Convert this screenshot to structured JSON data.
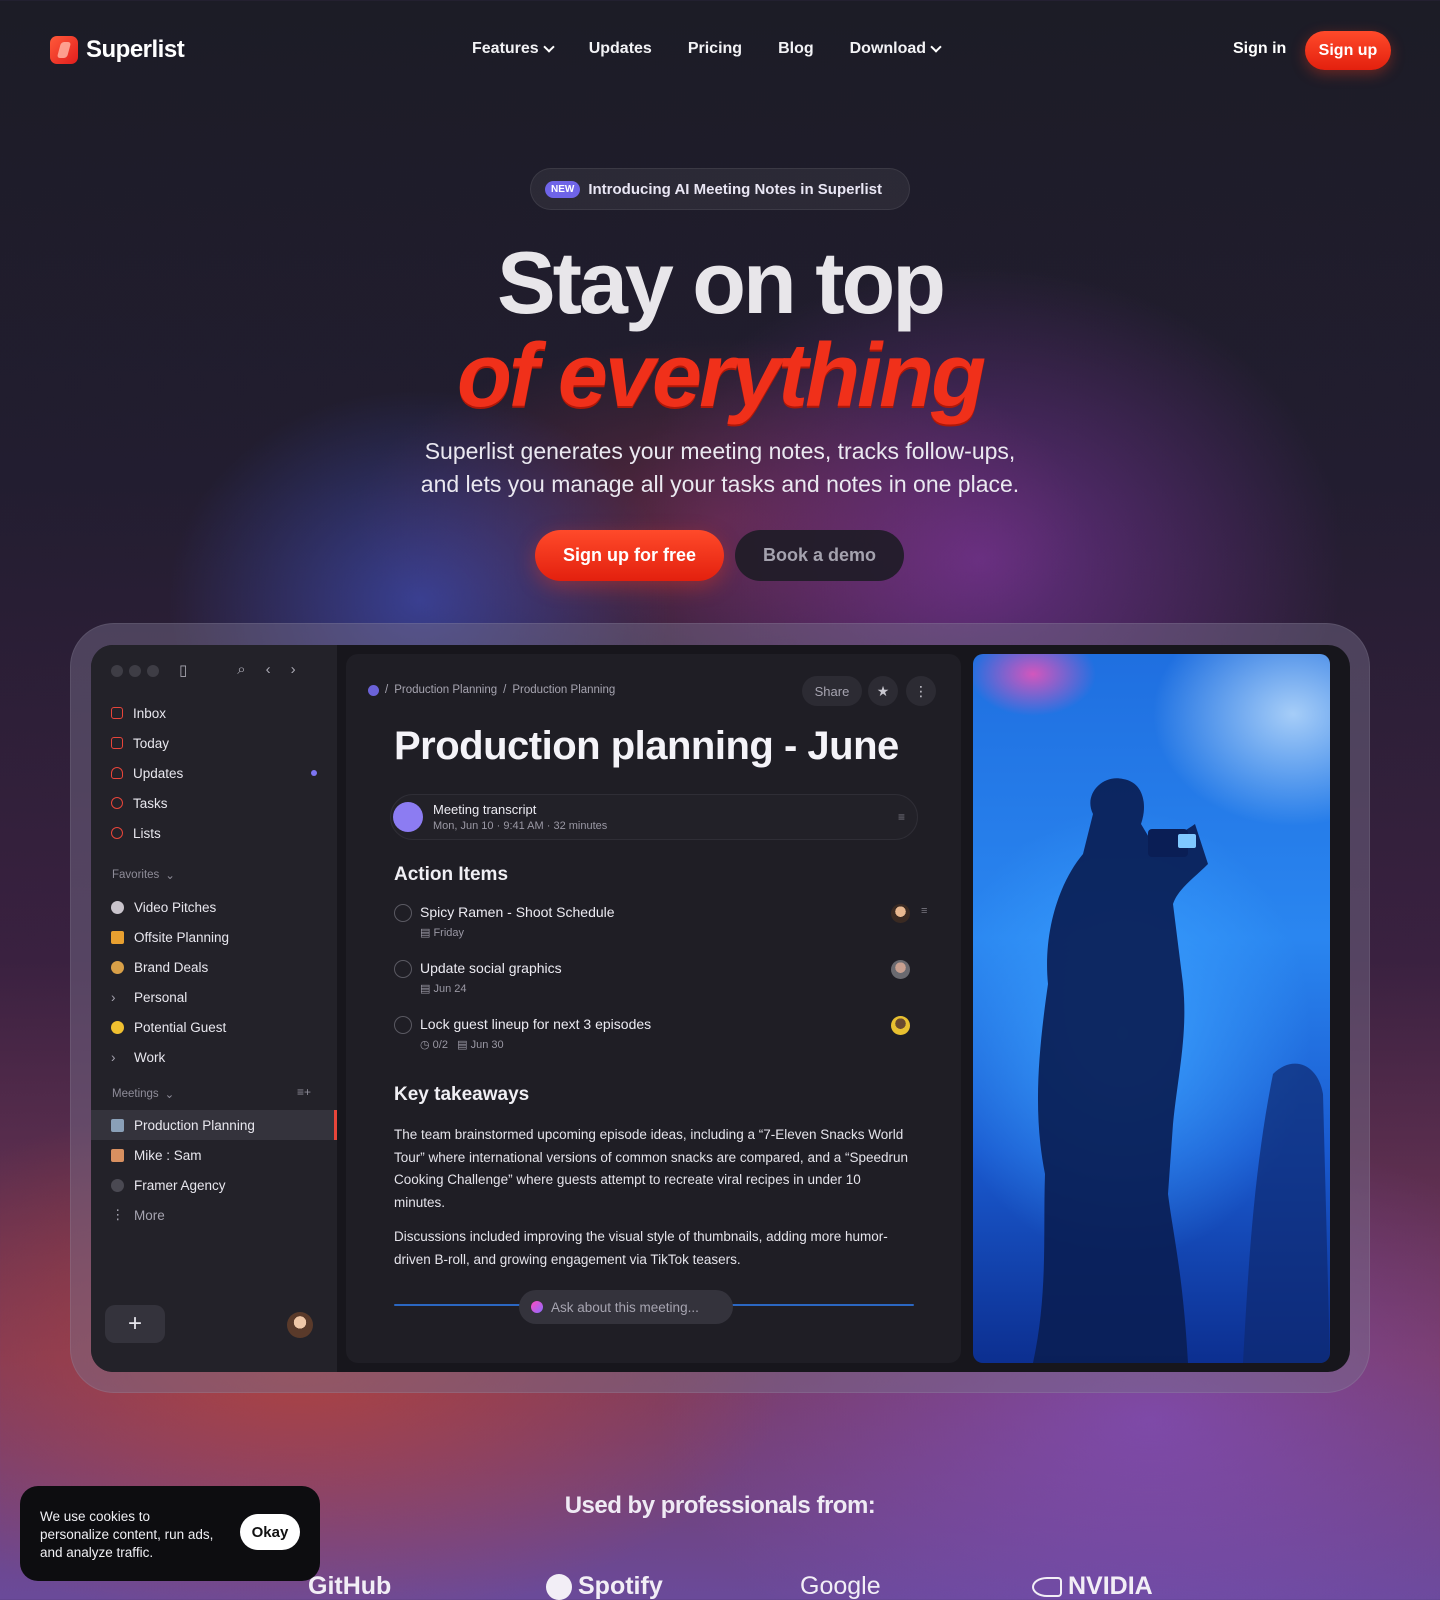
{
  "nav": {
    "brand": "Superlist",
    "links": [
      {
        "label": "Features",
        "dropdown": true
      },
      {
        "label": "Updates"
      },
      {
        "label": "Pricing"
      },
      {
        "label": "Blog"
      },
      {
        "label": "Download",
        "dropdown": true
      }
    ],
    "sign_in": "Sign in",
    "sign_up": "Sign up"
  },
  "hero": {
    "badge": "NEW",
    "announcement": "Introducing AI Meeting Notes in Superlist",
    "title_line1": "Stay on top",
    "title_line2": "of everything",
    "subtitle_line1": "Superlist generates your meeting notes, tracks follow-ups,",
    "subtitle_line2": "and lets you manage all your tasks and notes in one place.",
    "cta_primary": "Sign up for free",
    "cta_secondary": "Book a demo"
  },
  "app": {
    "sidebar": {
      "main": [
        {
          "label": "Inbox",
          "icon": "inbox-icon"
        },
        {
          "label": "Today",
          "icon": "calendar-icon"
        },
        {
          "label": "Updates",
          "icon": "bell-icon",
          "unread": true
        },
        {
          "label": "Tasks",
          "icon": "check-circle-icon"
        },
        {
          "label": "Lists",
          "icon": "list-icon"
        }
      ],
      "favorites_label": "Favorites",
      "favorites": [
        {
          "label": "Video Pitches"
        },
        {
          "label": "Offsite Planning"
        },
        {
          "label": "Brand Deals"
        },
        {
          "label": "Personal",
          "collapsed": true
        },
        {
          "label": "Potential Guest"
        },
        {
          "label": "Work",
          "collapsed": true
        }
      ],
      "meetings_label": "Meetings",
      "meetings": [
        {
          "label": "Production Planning",
          "active": true
        },
        {
          "label": "Mike : Sam"
        },
        {
          "label": "Framer Agency"
        },
        {
          "label": "More"
        }
      ]
    },
    "doc": {
      "breadcrumb": [
        "Production Planning",
        "Production Planning"
      ],
      "share": "Share",
      "title": "Production planning - June",
      "transcript": {
        "title": "Meeting transcript",
        "date": "Mon, Jun 10",
        "time": "9:41 AM",
        "duration": "32 minutes"
      },
      "action_items_heading": "Action Items",
      "tasks": [
        {
          "title": "Spicy Ramen - Shoot Schedule",
          "meta": "Friday"
        },
        {
          "title": "Update social graphics",
          "meta": "Jun 24"
        },
        {
          "title": "Lock guest lineup for next 3 episodes",
          "subtasks": "0/2",
          "meta": "Jun 30"
        }
      ],
      "takeaways_heading": "Key takeaways",
      "paragraph1": "The team brainstormed upcoming episode ideas, including a “7-Eleven Snacks World Tour” where international versions of common snacks are compared, and a “Speedrun Cooking Challenge” where guests attempt to recreate viral recipes in under 10 minutes.",
      "paragraph2": "Discussions included improving the visual style of thumbnails, adding more humor-driven B-roll, and growing engagement via TikTok teasers.",
      "ask_placeholder": "Ask about this meeting..."
    }
  },
  "cookie": {
    "text": "We use cookies to personalize content, run ads, and analyze traffic.",
    "button": "Okay"
  },
  "social_proof": {
    "heading": "Used by professionals from:",
    "brands": [
      "GitHub",
      "Spotify",
      "Google",
      "NVIDIA"
    ]
  },
  "colors": {
    "accent": "#f0301a",
    "violet": "#6f64e8"
  }
}
